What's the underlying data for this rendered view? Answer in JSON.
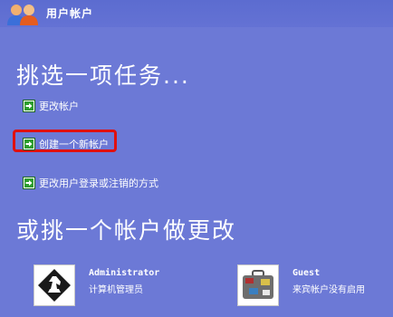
{
  "window": {
    "title": "用户帐户",
    "title_icon": "users-icon"
  },
  "tasks": {
    "heading": "挑选一项任务...",
    "items": [
      {
        "label": "更改帐户",
        "icon": "green-arrow-icon"
      },
      {
        "label": "创建一个新帐户",
        "icon": "green-arrow-icon",
        "highlighted": true
      },
      {
        "label": "更改用户登录或注销的方式",
        "icon": "green-arrow-icon"
      }
    ]
  },
  "accounts": {
    "heading": "或挑一个帐户做更改",
    "items": [
      {
        "name": "Administrator",
        "description": "计算机管理员",
        "picture": "chess-knight-icon"
      },
      {
        "name": "Guest",
        "description": "来宾帐户没有启用",
        "picture": "suitcase-icon"
      }
    ]
  },
  "colors": {
    "background": "#6c79d6",
    "highlight_border": "#e01010",
    "arrow_green": "#2e9e2e"
  }
}
